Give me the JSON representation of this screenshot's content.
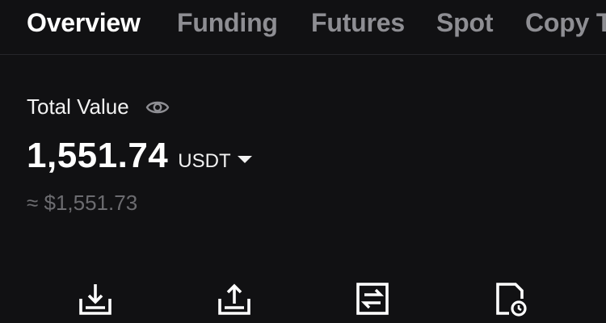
{
  "tabs": [
    {
      "label": "Overview",
      "active": true
    },
    {
      "label": "Funding",
      "active": false
    },
    {
      "label": "Futures",
      "active": false
    },
    {
      "label": "Spot",
      "active": false
    },
    {
      "label": "Copy T",
      "active": false
    }
  ],
  "overview": {
    "total_label": "Total Value",
    "total_value": "1,551.74",
    "currency": "USDT",
    "approx_value": "≈ $1,551.73"
  },
  "actions": [
    {
      "icon": "deposit-icon"
    },
    {
      "icon": "withdraw-icon"
    },
    {
      "icon": "transfer-icon"
    },
    {
      "icon": "history-icon"
    }
  ],
  "colors": {
    "background": "#111113",
    "active_tab": "#ffffff",
    "inactive_tab": "#8e8e93",
    "muted_text": "#6c6c70"
  }
}
